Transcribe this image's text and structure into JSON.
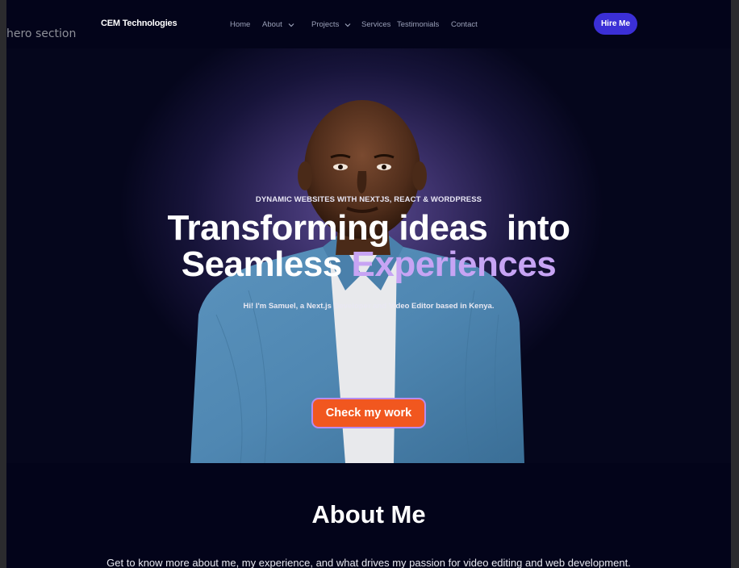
{
  "canvas": {
    "label": "hero section"
  },
  "nav": {
    "brand": "CEM Technologies",
    "links": [
      {
        "label": "Home",
        "dropdown": false
      },
      {
        "label": "About",
        "dropdown": true
      },
      {
        "label": "Projects",
        "dropdown": true
      },
      {
        "label": "Services",
        "dropdown": false
      },
      {
        "label": "Testimonials",
        "dropdown": false
      },
      {
        "label": "Contact",
        "dropdown": false
      }
    ],
    "cta_label": "Hire Me"
  },
  "hero": {
    "tagline": "DYNAMIC WEBSITES WITH NEXTJS, REACT & WORDPRESS",
    "headline_line1": "Transforming ideas  into",
    "headline_line2_prefix": "Seamless ",
    "headline_line2_accent": "Experiences",
    "intro": "Hi! I'm Samuel, a Next.js Developer and Video Editor based in Kenya.",
    "cta_label": "Check my work"
  },
  "about": {
    "title": "About Me",
    "text": "Get to know more about me, my experience, and what drives my passion for video editing and web development."
  },
  "colors": {
    "background": "#03041a",
    "hire_button": "#3b2fd6",
    "cta_button": "#f1571f",
    "accent_text": "#c7a4f4"
  }
}
